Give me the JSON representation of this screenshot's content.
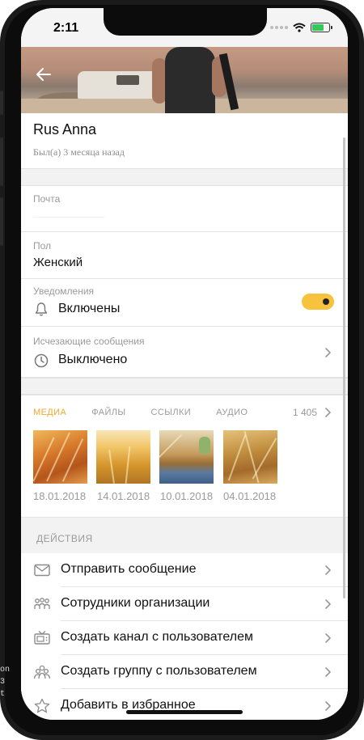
{
  "status_bar": {
    "time": "2:11"
  },
  "profile": {
    "name": "Rus Anna",
    "last_seen": "Был(а) 3 месяца назад"
  },
  "fields": {
    "email": {
      "label": "Почта",
      "value": ""
    },
    "gender": {
      "label": "Пол",
      "value": "Женский"
    },
    "notifications": {
      "label": "Уведомления",
      "value": "Включены",
      "enabled": true
    },
    "disappearing": {
      "label": "Исчезающие сообщения",
      "value": "Выключено"
    }
  },
  "media": {
    "tabs": [
      {
        "label": "МЕДИА",
        "active": true
      },
      {
        "label": "ФАЙЛЫ",
        "active": false
      },
      {
        "label": "ССЫЛКИ",
        "active": false
      },
      {
        "label": "АУДИО",
        "active": false
      }
    ],
    "count": "1 405",
    "items": [
      {
        "date": "18.01.2018"
      },
      {
        "date": "14.01.2018"
      },
      {
        "date": "10.01.2018"
      },
      {
        "date": "04.01.2018"
      }
    ]
  },
  "actions": {
    "title": "ДЕЙСТВИЯ",
    "items": [
      {
        "label": "Отправить сообщение",
        "icon": "envelope-icon"
      },
      {
        "label": "Сотрудники организации",
        "icon": "employees-icon"
      },
      {
        "label": "Создать канал с пользователем",
        "icon": "channel-icon"
      },
      {
        "label": "Создать группу с пользователем",
        "icon": "group-icon"
      },
      {
        "label": "Добавить в избранное",
        "icon": "star-icon"
      }
    ]
  },
  "colors": {
    "accent": "#f0a830",
    "toggle": "#f7c33c",
    "secondary_text": "#9a9a9a",
    "section_bg": "#f2f2f2"
  },
  "edge_text": [
    "on",
    "3",
    "t"
  ]
}
